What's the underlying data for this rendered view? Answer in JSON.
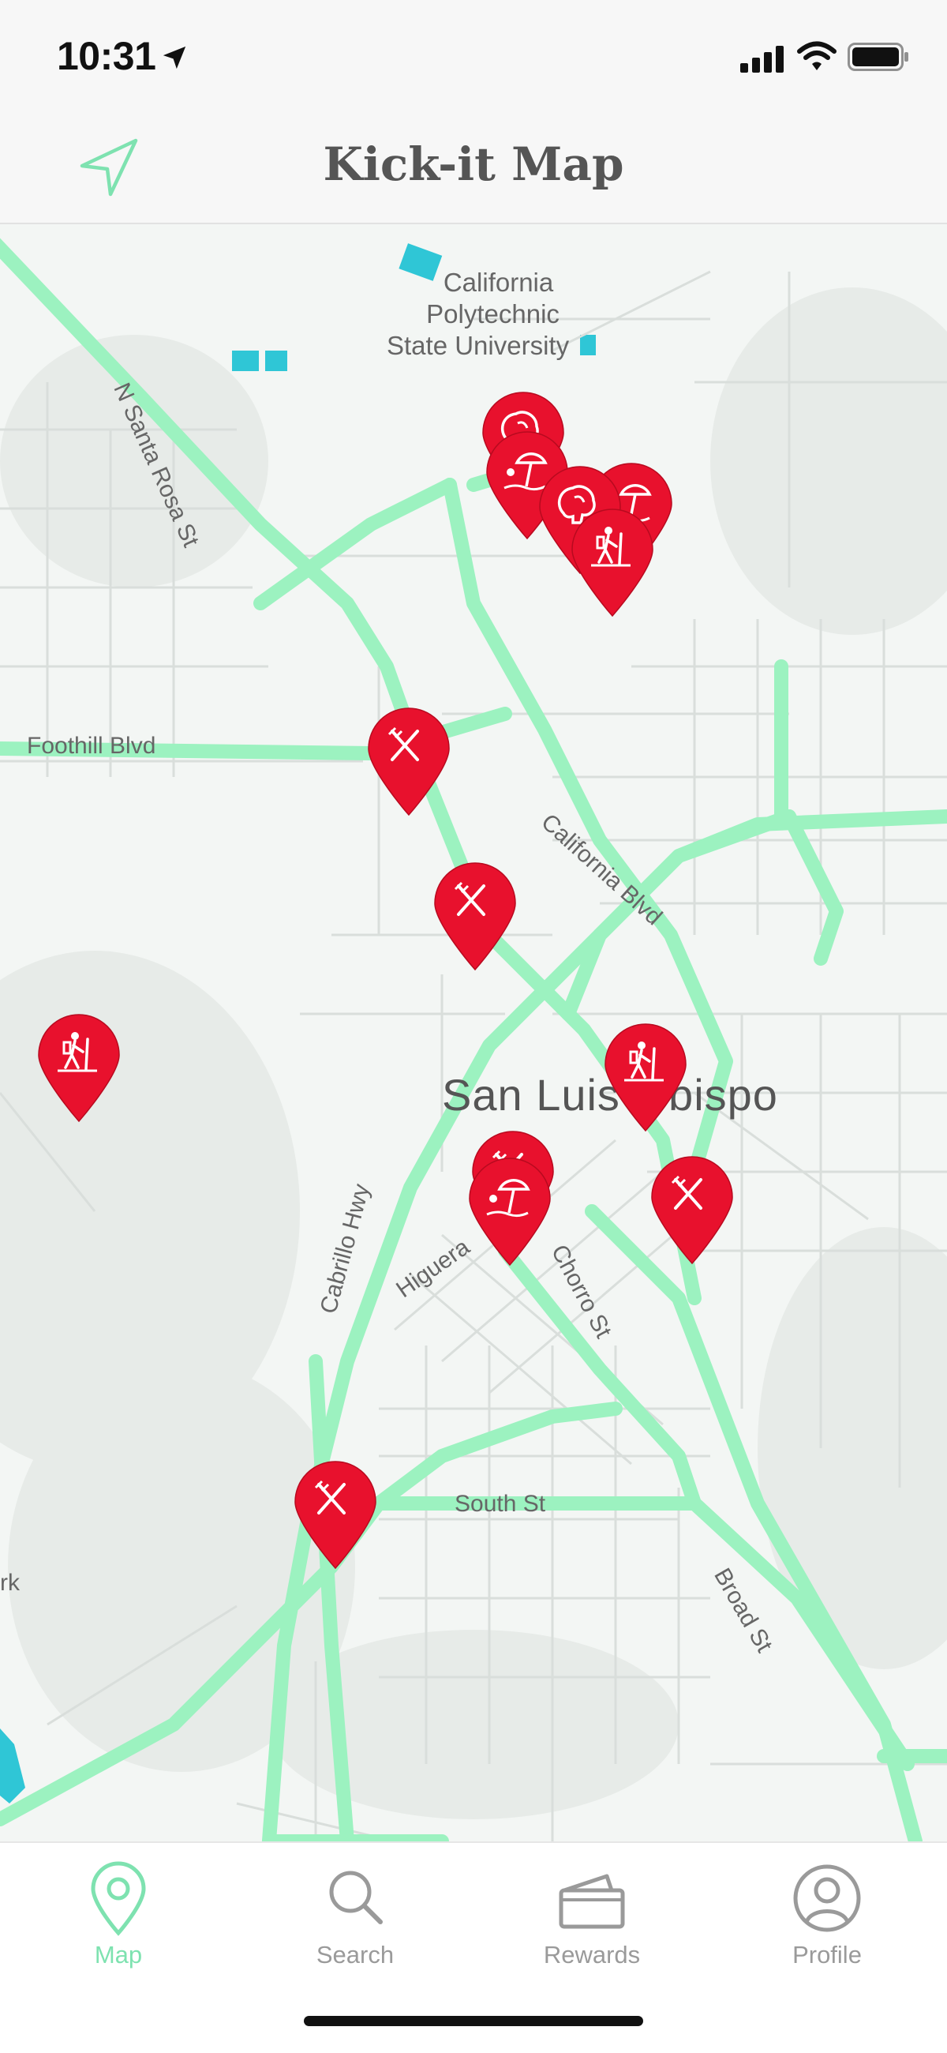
{
  "status_bar": {
    "time": "10:31"
  },
  "nav": {
    "title": "Kick-it Map"
  },
  "map": {
    "labels": {
      "campus_line1": "California",
      "campus_line2": "Polytechnic",
      "campus_line3": "State University",
      "santa_rosa": "N Santa Rosa St",
      "foothill": "Foothill Blvd",
      "california_blvd": "California Blvd",
      "city": "San Luis Obispo",
      "cabrillo": "Cabrillo Hwy",
      "higuera": "Higuera",
      "chorro": "Chorro St",
      "south_st": "South St",
      "broad_st": "Broad St",
      "edge_fragment": "rk"
    },
    "pin_color": "#e8112d",
    "pins": [
      {
        "name": "pin-brain-1",
        "icon": "brain-icon"
      },
      {
        "name": "pin-beach-1",
        "icon": "beach-icon"
      },
      {
        "name": "pin-beach-2",
        "icon": "beach-icon"
      },
      {
        "name": "pin-brain-2",
        "icon": "brain-icon"
      },
      {
        "name": "pin-hike-1",
        "icon": "hiking-icon"
      },
      {
        "name": "pin-food-1",
        "icon": "food-icon"
      },
      {
        "name": "pin-food-2",
        "icon": "food-icon"
      },
      {
        "name": "pin-hike-2",
        "icon": "hiking-icon"
      },
      {
        "name": "pin-hike-3",
        "icon": "hiking-icon"
      },
      {
        "name": "pin-food-3",
        "icon": "food-icon"
      },
      {
        "name": "pin-beach-3",
        "icon": "beach-icon"
      },
      {
        "name": "pin-food-4",
        "icon": "food-icon"
      },
      {
        "name": "pin-food-5",
        "icon": "food-icon"
      }
    ]
  },
  "tabs": [
    {
      "label": "Map",
      "icon": "map-pin-icon",
      "active": true
    },
    {
      "label": "Search",
      "icon": "search-icon",
      "active": false
    },
    {
      "label": "Rewards",
      "icon": "wallet-icon",
      "active": false
    },
    {
      "label": "Profile",
      "icon": "profile-icon",
      "active": false
    }
  ],
  "colors": {
    "accent": "#7ee2b0",
    "road_major": "#9cf2c0",
    "pin": "#e8112d",
    "water": "#2fc6d6"
  }
}
